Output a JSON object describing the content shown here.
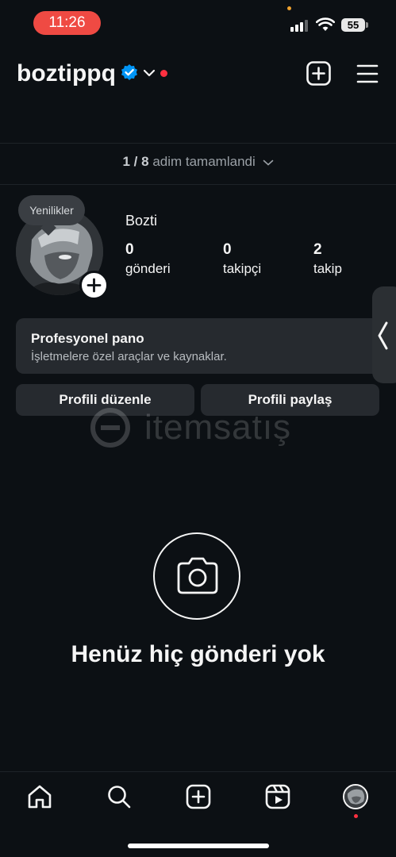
{
  "status_bar": {
    "time": "11:26",
    "battery": "55"
  },
  "header": {
    "username": "boztippq",
    "icons": [
      "verified-badge-icon",
      "chevron-down-icon",
      "notification-dot",
      "add-post-icon",
      "menu-icon"
    ]
  },
  "onboarding": {
    "progress_count": "1 / 8",
    "progress_label": "adim tamamlandi"
  },
  "profile": {
    "bubble_label": "Yenilikler",
    "display_name": "Bozti",
    "stats": [
      {
        "value": "0",
        "label": "gönderi"
      },
      {
        "value": "0",
        "label": "takipçi"
      },
      {
        "value": "2",
        "label": "takip"
      }
    ]
  },
  "pro_dashboard": {
    "title": "Profesyonel pano",
    "subtitle": "İşletmelere özel araçlar ve kaynaklar."
  },
  "actions": {
    "edit_profile": "Profili düzenle",
    "share_profile": "Profili paylaş"
  },
  "watermark": "itemsatış",
  "empty_state": {
    "message": "Henüz hiç gönderi yok"
  },
  "bottom_nav": {
    "icons": [
      "home-icon",
      "search-icon",
      "create-icon",
      "reels-icon",
      "profile-avatar"
    ]
  },
  "colors": {
    "background": "#0c1014",
    "card": "#262a2f",
    "verified_blue": "#0095f6",
    "notification_red": "#ff3040",
    "time_pill": "#ef4a43"
  }
}
